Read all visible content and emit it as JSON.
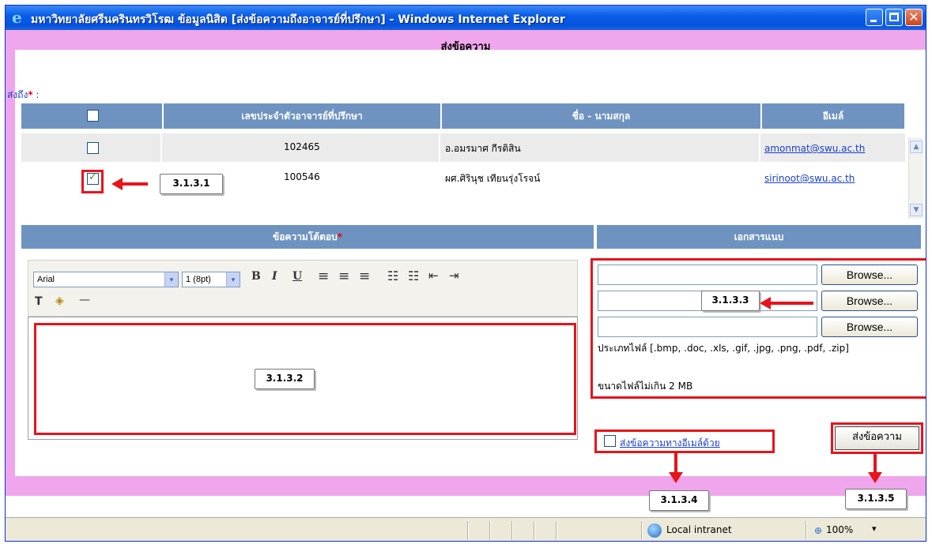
{
  "window": {
    "ie_icon": "e",
    "title": "มหาวิทยาลัยศรีนครินทรวิโรฒ ข้อมูลนิสิต [ส่งข้อความถึงอาจารย์ที่ปรึกษา] - Windows Internet Explorer",
    "close_glyph": "✕"
  },
  "form": {
    "heading": "ส่งข้อความ",
    "send_to_label": "ส่งถึง",
    "required_mark": "*",
    "send_to_colon": " :"
  },
  "advisor_table": {
    "columns": [
      "เลขประจำตัวอาจารย์ที่ปรึกษา",
      "ชื่อ - นามสกุล",
      "อีเมล์"
    ],
    "rows": [
      {
        "id": "102465",
        "name": "อ.อมรมาศ กีรติสิน",
        "email": "amonmat@swu.ac.th",
        "checked": false
      },
      {
        "id": "100546",
        "name": "ผศ.ศิรินุช เทียนรุ่งโรจน์",
        "email": "sirinoot@swu.ac.th",
        "checked": true
      }
    ],
    "scroll_up": "▲",
    "scroll_down": "▼"
  },
  "reply_section": {
    "header": "ข้อความโต้ตอบ",
    "required_mark": "*",
    "font_select": "Arial",
    "size_select": "1 (8pt)",
    "bold": "B",
    "italic": "I",
    "underline": "U",
    "align_left": "≡",
    "align_center": "≡",
    "align_right": "≡",
    "ordered_list": "☷",
    "bullet_list": "☷",
    "outdent": "⇤",
    "indent": "⇥",
    "text_color": "T",
    "bg_color": "◈",
    "hr": "—",
    "dropdown_glyph": "▾"
  },
  "attachment_section": {
    "header": "เอกสารแนบ",
    "browse_label": "Browse...",
    "file_types": "ประเภทไฟล์ [.bmp, .doc, .xls, .gif, .jpg, .png, .pdf, .zip]",
    "max_size": "ขนาดไฟล์ไม่เกิน 2 MB"
  },
  "email_option": {
    "label": "ส่งข้อความทางอีเมล์ด้วย"
  },
  "send_button": {
    "label": "ส่งข้อความ"
  },
  "callouts": {
    "c1": "3.1.3.1",
    "c2": "3.1.3.2",
    "c3": "3.1.3.3",
    "c4": "3.1.3.4",
    "c5": "3.1.3.5"
  },
  "statusbar": {
    "zone": "Local intranet",
    "zoom_icon": "⊕",
    "zoom": "100%",
    "zoom_dropdown": "▾"
  },
  "colors": {
    "accent_header": "#6e93c0",
    "page_frame": "#f0a6ec",
    "annotation_red": "#e8131b"
  }
}
